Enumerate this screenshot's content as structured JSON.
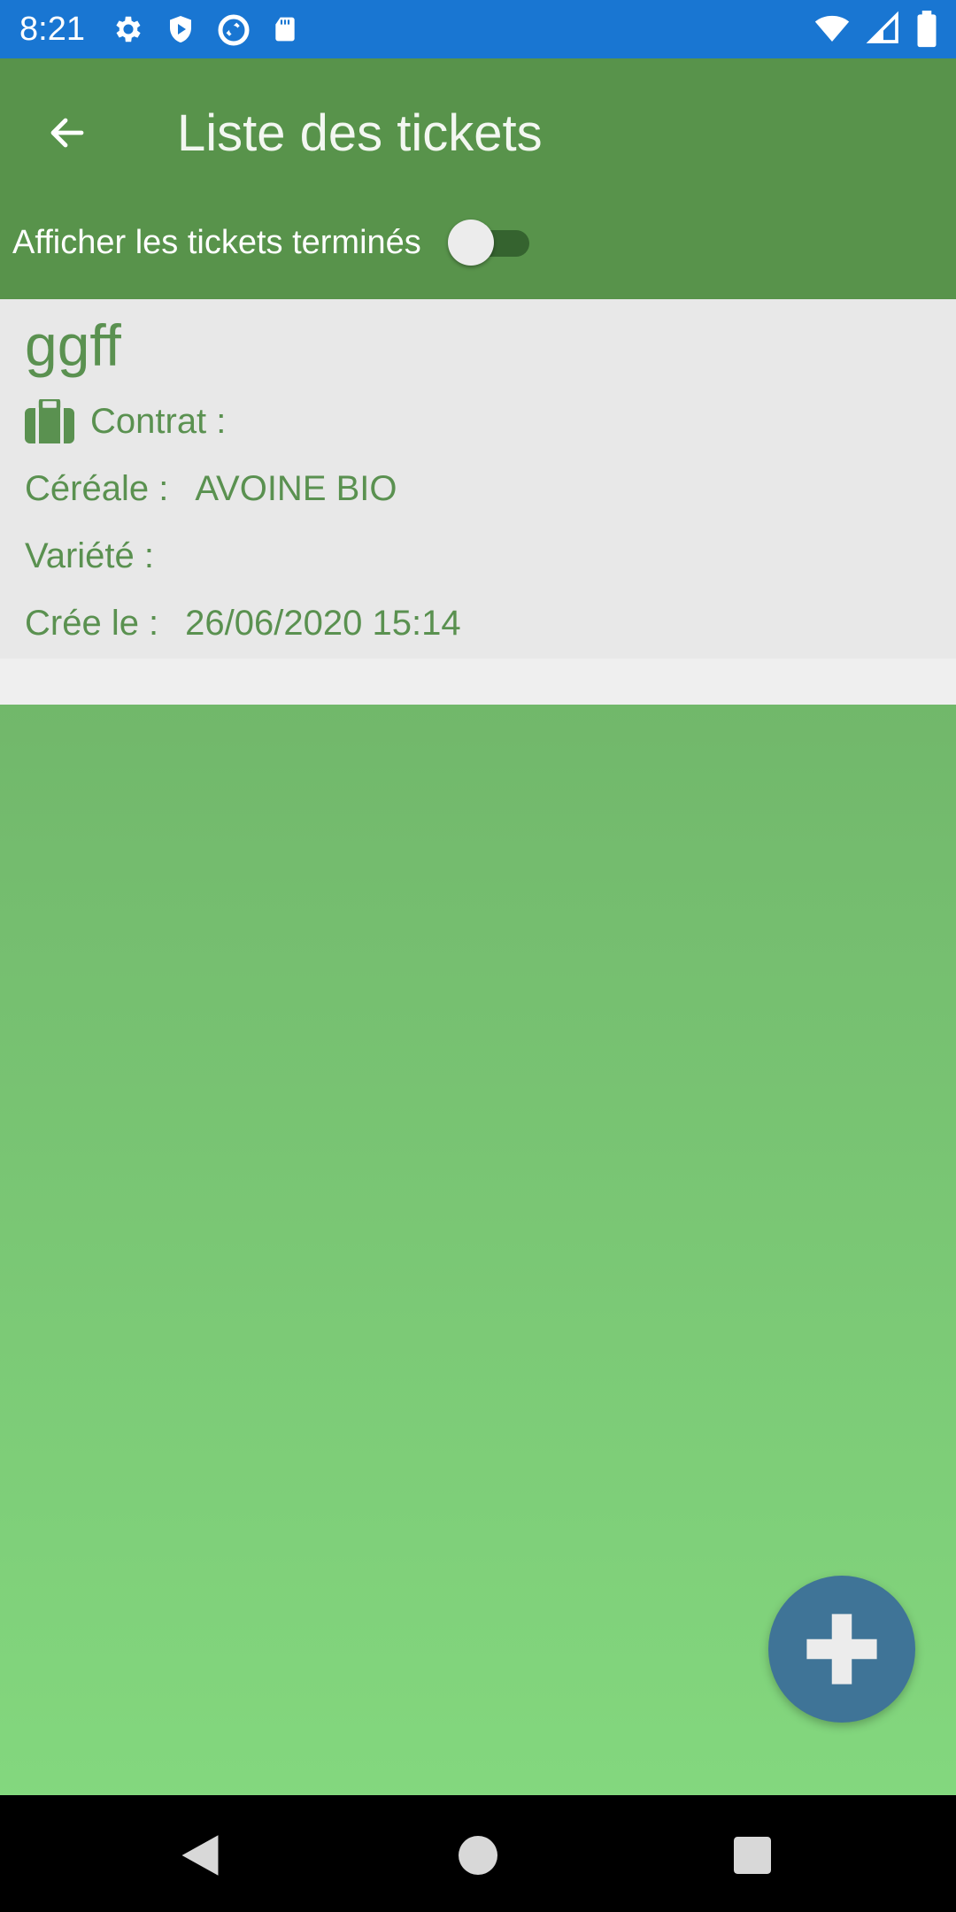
{
  "status_bar": {
    "time": "8:21",
    "left_icons": [
      "settings-gear-icon",
      "shield-play-icon",
      "data-saver-icon",
      "sd-card-icon"
    ],
    "right_icons": [
      "wifi-icon",
      "cell-signal-icon",
      "battery-icon"
    ]
  },
  "app_bar": {
    "title": "Liste des tickets",
    "back_icon": "arrow-left-icon",
    "toggle_label": "Afficher les tickets terminés",
    "toggle_on": false
  },
  "tickets": [
    {
      "name": "ggff",
      "contract_label": "Contrat :",
      "contract_value": "",
      "cereal_label": "Céréale :",
      "cereal_value": "AVOINE BIO",
      "variety_label": "Variété :",
      "variety_value": "",
      "created_label": "Crée le :",
      "created_value": "26/06/2020 15:14"
    }
  ],
  "fab": {
    "icon": "plus-icon"
  },
  "nav_bar": {
    "icons": [
      "back-triangle-icon",
      "home-circle-icon",
      "recents-square-icon"
    ]
  },
  "colors": {
    "status_bar": "#1976d2",
    "app_bar": "#58934b",
    "card_text": "#5a9150",
    "fab": "#3f7497",
    "gradient_top": "#64a35a",
    "gradient_bottom": "#85db80"
  }
}
